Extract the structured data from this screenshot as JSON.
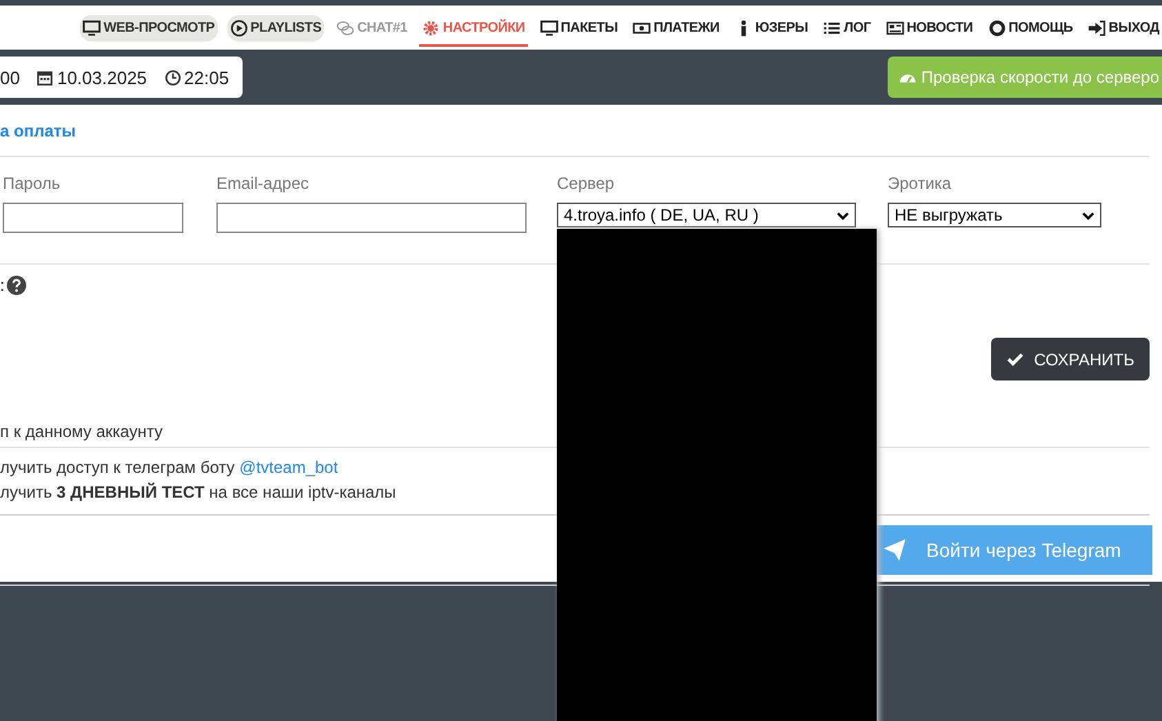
{
  "nav": [
    {
      "label": "WEB-ПРОСМОТР",
      "kind": "pill",
      "selected": false
    },
    {
      "label": "PLAYLISTS",
      "kind": "pill",
      "selected": false
    },
    {
      "label": "CHAT#1",
      "kind": "dim",
      "selected": false
    },
    {
      "label": "НАСТРОЙКИ",
      "kind": "plain",
      "selected": true
    },
    {
      "label": "ПАКЕТЫ",
      "kind": "plain",
      "selected": false
    },
    {
      "label": "ПЛАТЕЖИ",
      "kind": "plain",
      "selected": false
    },
    {
      "label": "ЮЗЕРЫ",
      "kind": "plain",
      "selected": false
    },
    {
      "label": "ЛОГ",
      "kind": "plain",
      "selected": false
    },
    {
      "label": "НОВОСТИ",
      "kind": "plain",
      "selected": false
    },
    {
      "label": "ПОМОЩЬ",
      "kind": "plain",
      "selected": false
    },
    {
      "label": "ВЫХОД",
      "kind": "plain",
      "selected": false
    }
  ],
  "info": {
    "balance": "00",
    "date": "10.03.2025",
    "time": "22:05"
  },
  "speed_button": "Проверка скорости до серверо",
  "payment_link": "а оплаты",
  "fields": [
    {
      "label": "Пароль",
      "kind": "input"
    },
    {
      "label": "Email-адрес",
      "kind": "input"
    },
    {
      "label": "Сервер",
      "kind": "select",
      "value": "4.troya.info ( DE, UA, RU )",
      "expanded": true
    },
    {
      "label": "Эротика",
      "kind": "select",
      "value": "НЕ выгружать",
      "expanded": false
    }
  ],
  "help_label": ":",
  "save_button": "СОХРАНИТЬ",
  "account_text": "п к данному аккаунту",
  "telegram_lines": [
    "лучить доступ к телеграм боту",
    "лучить **3 ДНЕВНЫЙ ТЕСТ** на все наши iptv-каналы"
  ],
  "bot_link": "@tvteam_bot",
  "telegram_button": "Войти через Telegram"
}
